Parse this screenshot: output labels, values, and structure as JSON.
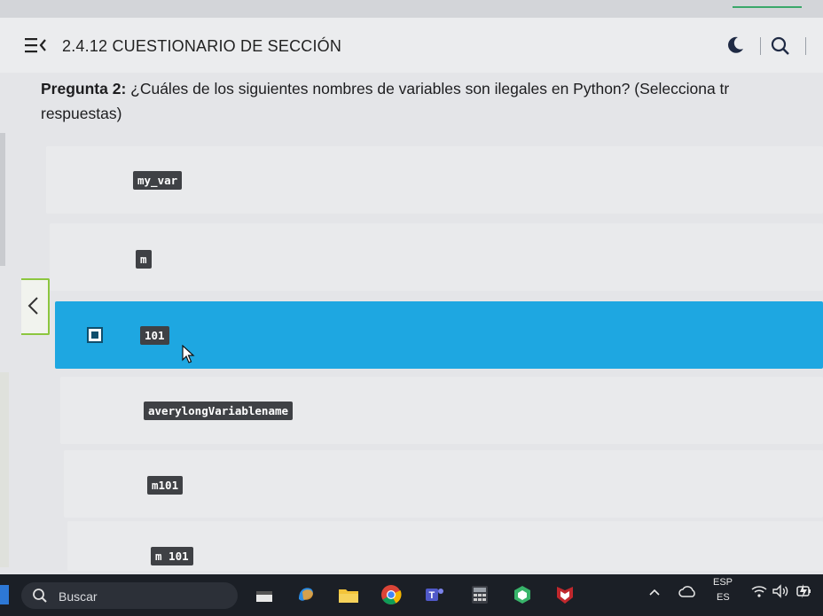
{
  "header": {
    "title": "2.4.12 CUESTIONARIO DE SECCIÓN"
  },
  "question": {
    "label": "Pregunta 2:",
    "text": " ¿Cuáles de los siguientes nombres de variables son ilegales en Python?  (Selecciona tr",
    "text_line2": "respuestas)"
  },
  "options": [
    {
      "code": "my_var",
      "selected": false
    },
    {
      "code": "m",
      "selected": false
    },
    {
      "code": "101",
      "selected": true
    },
    {
      "code": "averylongVariablename",
      "selected": false
    },
    {
      "code": "m101",
      "selected": false
    },
    {
      "code": "m 101",
      "selected": false
    }
  ],
  "taskbar": {
    "search_placeholder": "Buscar",
    "lang_top": "ESP",
    "lang_bottom": "ES"
  },
  "colors": {
    "selected_option": "#1ea7e1",
    "back_button_border": "#8cc63f"
  }
}
